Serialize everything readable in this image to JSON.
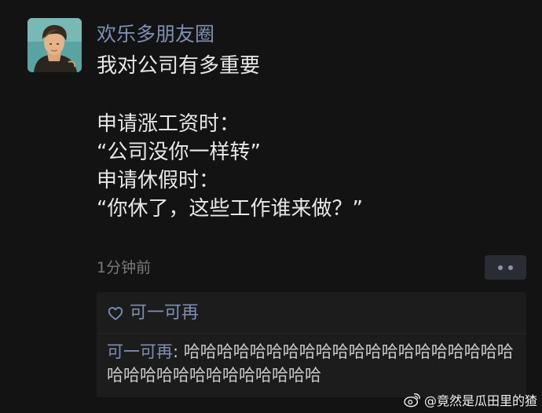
{
  "post": {
    "author": "欢乐多朋友圈",
    "lines": [
      "我对公司有多重要",
      "",
      "申请涨工资时：",
      "“公司没你一样转”",
      "申请休假时：",
      "“你休了，这些工作谁来做？”"
    ],
    "timestamp": "1分钟前",
    "avatar_icon": "illustrated-man-portrait"
  },
  "likes": {
    "icon": "heart-outline-icon",
    "names": "可一可再"
  },
  "comment": {
    "author": "可一可再",
    "separator": ": ",
    "text": "哈哈哈哈哈哈哈哈哈哈哈哈哈哈哈哈哈哈哈哈哈哈哈哈哈哈哈哈哈哈哈哈哈"
  },
  "watermark": {
    "icon": "weibo-icon",
    "text": "@竟然是瓜田里的猹"
  },
  "colors": {
    "background": "#131313",
    "link_blue": "#7e8fb3",
    "text": "#e7e7e7",
    "muted": "#7a7a7a",
    "panel": "#1c1c1c"
  }
}
